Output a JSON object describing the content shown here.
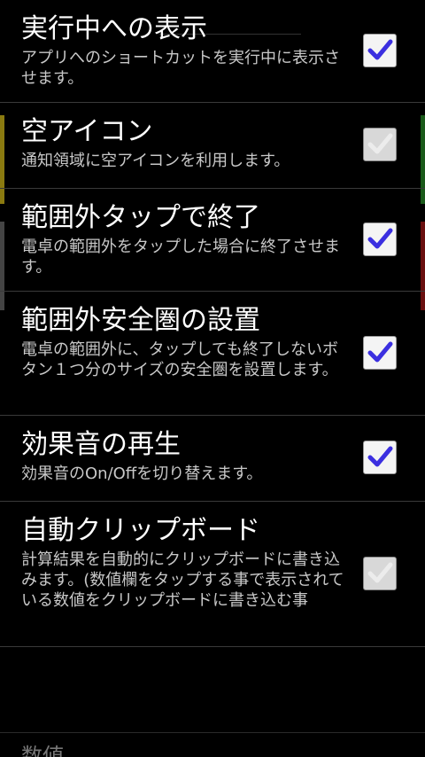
{
  "preferences": [
    {
      "title": "実行中への表示",
      "summary": "アプリへのショートカットを実行中に表示させます。",
      "checked": true,
      "enabled": true
    },
    {
      "title": "空アイコン",
      "summary": "通知領域に空アイコンを利用します。",
      "checked": true,
      "enabled": false
    },
    {
      "title": "範囲外タップで終了",
      "summary": "電卓の範囲外をタップした場合に終了させます。",
      "checked": true,
      "enabled": true
    },
    {
      "title": "範囲外安全圏の設置",
      "summary": "電卓の範囲外に、タップしても終了しないボタン１つ分のサイズの安全圏を設置します。",
      "checked": true,
      "enabled": true
    },
    {
      "title": "効果音の再生",
      "summary": "効果音のOn/Offを切り替えます。",
      "checked": true,
      "enabled": true
    },
    {
      "title": "自動クリップボード",
      "summary": "計算結果を自動的にクリップボードに書き込みます。(数値欄をタップする事で表示されている数値をクリップボードに書き込む事",
      "checked": true,
      "enabled": false
    }
  ],
  "category_header": "数値",
  "colors": {
    "check_enabled": "#3b2fe0",
    "check_disabled": "#e8e8e8",
    "edge_yellow": "#8a7a10",
    "edge_green": "#1a5a1a",
    "edge_gray": "#444444",
    "edge_red": "#6a0f0f"
  },
  "icons": {
    "check": "checkmark-icon"
  }
}
